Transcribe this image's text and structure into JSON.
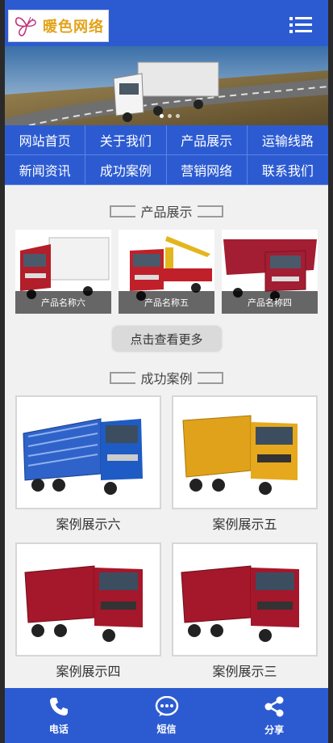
{
  "header": {
    "logo_text": "暖色网络",
    "logo_icon": "butterfly-icon",
    "menu_icon": "list-menu-icon"
  },
  "banner": {
    "slides": 3,
    "active_slide": 1
  },
  "nav": {
    "items": [
      "网站首页",
      "关于我们",
      "产品展示",
      "运输线路",
      "新闻资讯",
      "成功案例",
      "营销网络",
      "联系我们"
    ]
  },
  "products": {
    "title": "产品展示",
    "items": [
      {
        "name": "产品名称六",
        "color": "#b21e2a"
      },
      {
        "name": "产品名称五",
        "color": "#c0202a"
      },
      {
        "name": "产品名称四",
        "color": "#a31d33"
      }
    ],
    "more_label": "点击查看更多"
  },
  "cases": {
    "title": "成功案例",
    "items": [
      {
        "name": "案例展示六",
        "color": "#1f5bc4"
      },
      {
        "name": "案例展示五",
        "color": "#e6a81c"
      },
      {
        "name": "案例展示四",
        "color": "#a5172a"
      },
      {
        "name": "案例展示三",
        "color": "#a5172a"
      }
    ]
  },
  "footer": {
    "items": [
      {
        "label": "电话",
        "icon": "phone-icon"
      },
      {
        "label": "短信",
        "icon": "sms-icon"
      },
      {
        "label": "分享",
        "icon": "share-icon"
      }
    ]
  },
  "colors": {
    "brand_blue": "#2c5bd1",
    "logo_gold": "#e2a31a",
    "page_bg": "#f1f1f1"
  }
}
